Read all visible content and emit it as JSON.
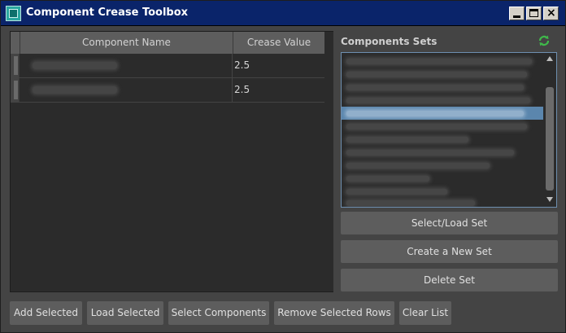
{
  "window": {
    "title": "Component Crease Toolbox",
    "icon": "maya-app-icon",
    "controls": [
      "minimize",
      "maximize",
      "close"
    ],
    "close_glyph": "×"
  },
  "table": {
    "columns": [
      "Component Name",
      "Crease Value"
    ],
    "rows": [
      {
        "name": "",
        "crease": "2.5"
      },
      {
        "name": "",
        "crease": "2.5"
      }
    ]
  },
  "sets": {
    "label": "Components Sets",
    "refresh_icon": "refresh-icon",
    "selected_index": 5,
    "item_count": 12
  },
  "side_buttons": {
    "select_load": "Select/Load Set",
    "create": "Create a New Set",
    "delete": "Delete Set"
  },
  "bottom_buttons": {
    "add_selected": "Add Selected",
    "load_selected": "Load Selected",
    "select_components": "Select Components",
    "remove_rows": "Remove Selected Rows",
    "clear_list": "Clear List"
  },
  "colors": {
    "titlebar": "#0a246a",
    "panel": "#444444",
    "field": "#2b2b2b",
    "button": "#5d5d5d",
    "selection": "#5b86ad"
  }
}
